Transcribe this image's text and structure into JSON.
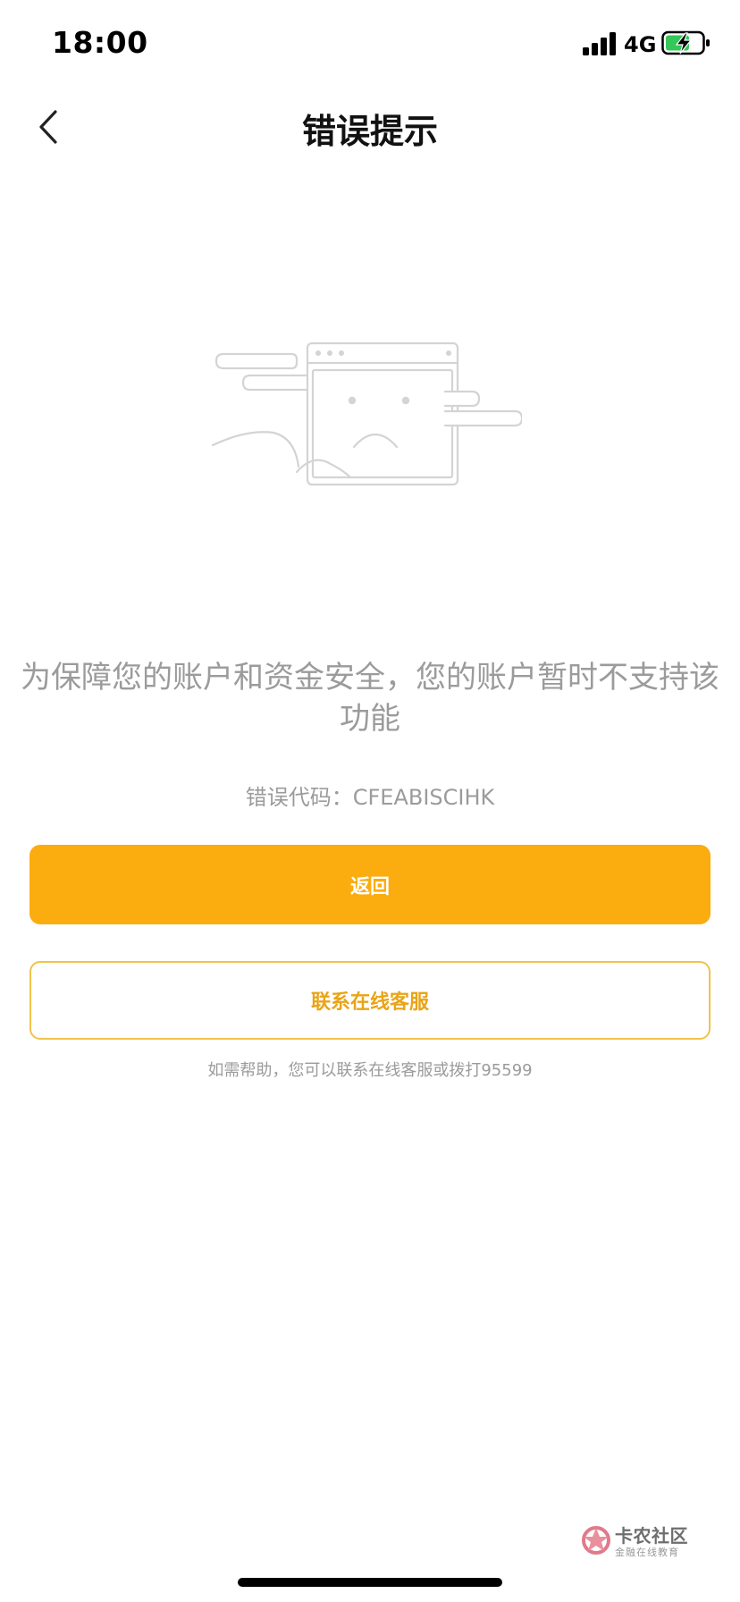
{
  "status_bar": {
    "time": "18:00",
    "network": "4G",
    "icons": [
      "signal-icon",
      "battery-charging-icon"
    ]
  },
  "nav": {
    "title": "错误提示",
    "back_icon": "chevron-left-icon"
  },
  "illustration": {
    "icon": "sad-browser-window-illustration"
  },
  "message": {
    "text": "为保障您的账户和资金安全，您的账户暂时不支持该功能"
  },
  "error_code": {
    "text": "错误代码：CFEABISCIHK"
  },
  "buttons": {
    "back_label": "返回",
    "contact_label": "联系在线客服"
  },
  "help": {
    "text": "如需帮助，您可以联系在线客服或拨打95599"
  },
  "watermark": {
    "title": "卡农社区",
    "subtitle": "金融在线教育"
  },
  "colors": {
    "accent": "#FBAC0E",
    "accent_text": "#E9A417",
    "outline": "#F0C34A",
    "muted_text": "#9b9b9b",
    "battery_charge": "#34C759"
  }
}
